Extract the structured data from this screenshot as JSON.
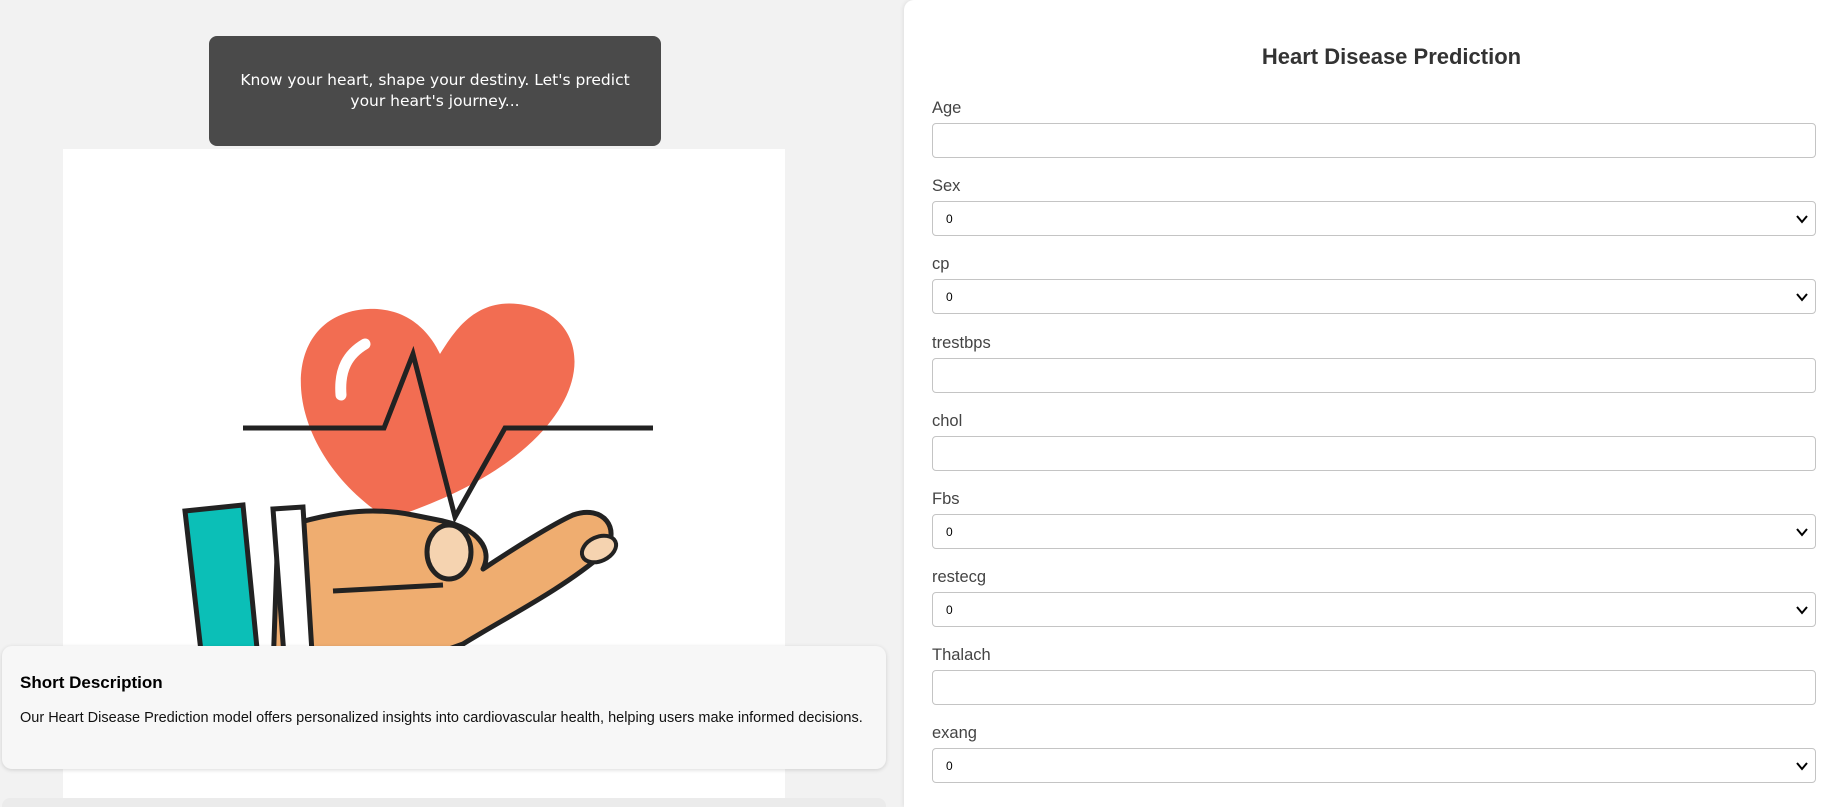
{
  "banner": {
    "text": "Know your heart, shape your destiny. Let's predict your heart's journey..."
  },
  "description": {
    "title": "Short Description",
    "text": "Our Heart Disease Prediction model offers personalized insights into cardiovascular health, helping users make informed decisions."
  },
  "form": {
    "title": "Heart Disease Prediction",
    "fields": [
      {
        "label": "Age",
        "type": "input",
        "value": ""
      },
      {
        "label": "Sex",
        "type": "select",
        "value": "0"
      },
      {
        "label": "cp",
        "type": "select",
        "value": "0"
      },
      {
        "label": "trestbps",
        "type": "input",
        "value": ""
      },
      {
        "label": "chol",
        "type": "input",
        "value": ""
      },
      {
        "label": "Fbs",
        "type": "select",
        "value": "0"
      },
      {
        "label": "restecg",
        "type": "select",
        "value": "0"
      },
      {
        "label": "Thalach",
        "type": "input",
        "value": ""
      },
      {
        "label": "exang",
        "type": "select",
        "value": "0"
      }
    ]
  },
  "colors": {
    "banner_bg": "#4a4a4a",
    "heart": "#f26d52",
    "hand": "#efad70",
    "sleeve": "#0bbfb7"
  }
}
